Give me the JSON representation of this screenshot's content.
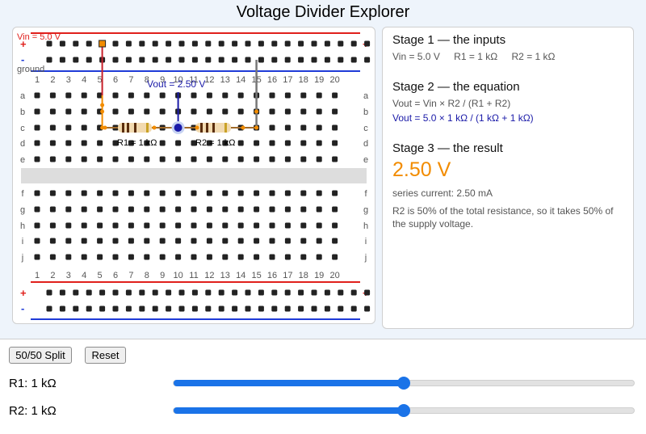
{
  "title": "Voltage Divider Explorer",
  "board": {
    "vin_label": "Vin = 5.0 V",
    "ground_label": "ground",
    "vout_label": "Vout = 2.50 V",
    "r1_label": "R1 = 1 kΩ",
    "r2_label": "R2 = 1 kΩ",
    "columns": [
      "1",
      "2",
      "3",
      "4",
      "5",
      "6",
      "7",
      "8",
      "9",
      "10",
      "11",
      "12",
      "13",
      "14",
      "15",
      "16",
      "17",
      "18",
      "19",
      "20"
    ],
    "rows_top": [
      "a",
      "b",
      "c",
      "d",
      "e"
    ],
    "rows_bottom": [
      "f",
      "g",
      "h",
      "i",
      "j"
    ],
    "plus": "+",
    "minus": "-",
    "colors": {
      "positive_rail": "#e0201c",
      "negative_rail": "#1f3bd8",
      "vout_wire": "#1a1aa8",
      "wire_orange": "#f28c00"
    }
  },
  "stage1": {
    "title": "Stage 1 — the inputs",
    "vin": "Vin = 5.0 V",
    "r1": "R1 = 1 kΩ",
    "r2": "R2 = 1 kΩ"
  },
  "stage2": {
    "title": "Stage 2 — the equation",
    "formula": "Vout = Vin × R2 / (R1 + R2)",
    "substituted": "Vout = 5.0 × 1 kΩ / (1 kΩ + 1 kΩ)"
  },
  "stage3": {
    "title": "Stage 3 — the result",
    "result": "2.50 V",
    "current": "series current: 2.50 mA",
    "explanation": "R2 is 50% of the total resistance, so it takes 50% of the supply voltage."
  },
  "controls": {
    "split_label": "50/50 Split",
    "reset_label": "Reset",
    "r1_label": "R1: 1 kΩ",
    "r2_label": "R2: 1 kΩ",
    "r1_slider_fraction": 0.5,
    "r2_slider_fraction": 0.5,
    "accent": "#1a73e8"
  }
}
